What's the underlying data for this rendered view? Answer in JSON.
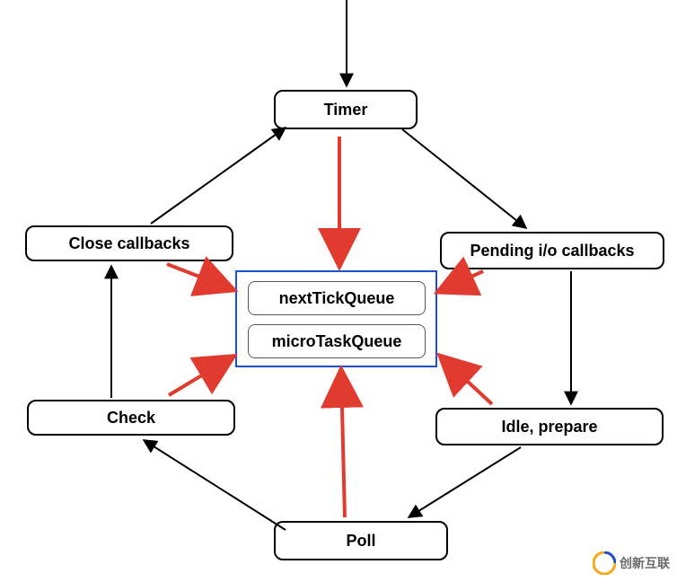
{
  "nodes": {
    "timer": "Timer",
    "close_callbacks": "Close callbacks",
    "pending_io": "Pending i/o callbacks",
    "check": "Check",
    "idle_prepare": "Idle, prepare",
    "poll": "Poll"
  },
  "center": {
    "next_tick": "nextTickQueue",
    "micro_task": "microTaskQueue"
  },
  "watermark": {
    "text": "创新互联"
  }
}
